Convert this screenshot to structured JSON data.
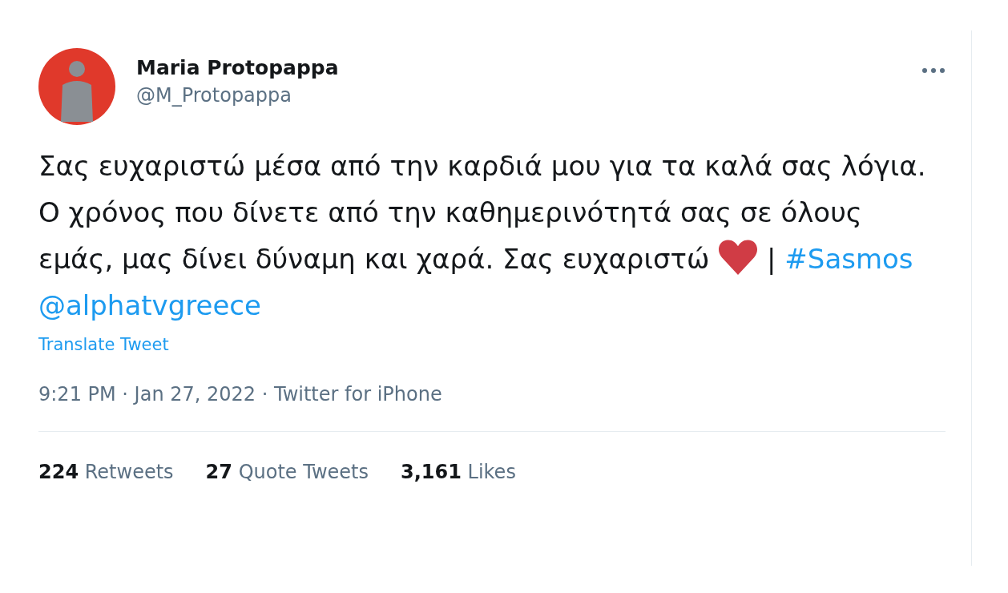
{
  "author": {
    "name": "Maria Protopappa",
    "handle": "@M_Protopappa"
  },
  "tweet": {
    "body": [
      {
        "kind": "text",
        "text": "Σας ευχαριστώ μέσα από την καρδιά μου για τα καλά σας λόγια. Ο χρόνος που δίνετε από την καθημερινότητά σας σε όλους εμάς, μας δίνει δύναμη και χαρά. Σας ευχαριστώ"
      },
      {
        "kind": "heart"
      },
      {
        "kind": "text",
        "text": "|"
      },
      {
        "kind": "link",
        "text": "#Sasmos"
      },
      {
        "kind": "link",
        "text": "@alphatvgreece"
      }
    ],
    "translate": "Translate Tweet",
    "meta": "9:21 PM · Jan 27, 2022 · Twitter for iPhone"
  },
  "stats": [
    {
      "count": "224",
      "label": "Retweets"
    },
    {
      "count": "27",
      "label": "Quote Tweets"
    },
    {
      "count": "3,161",
      "label": "Likes"
    }
  ]
}
